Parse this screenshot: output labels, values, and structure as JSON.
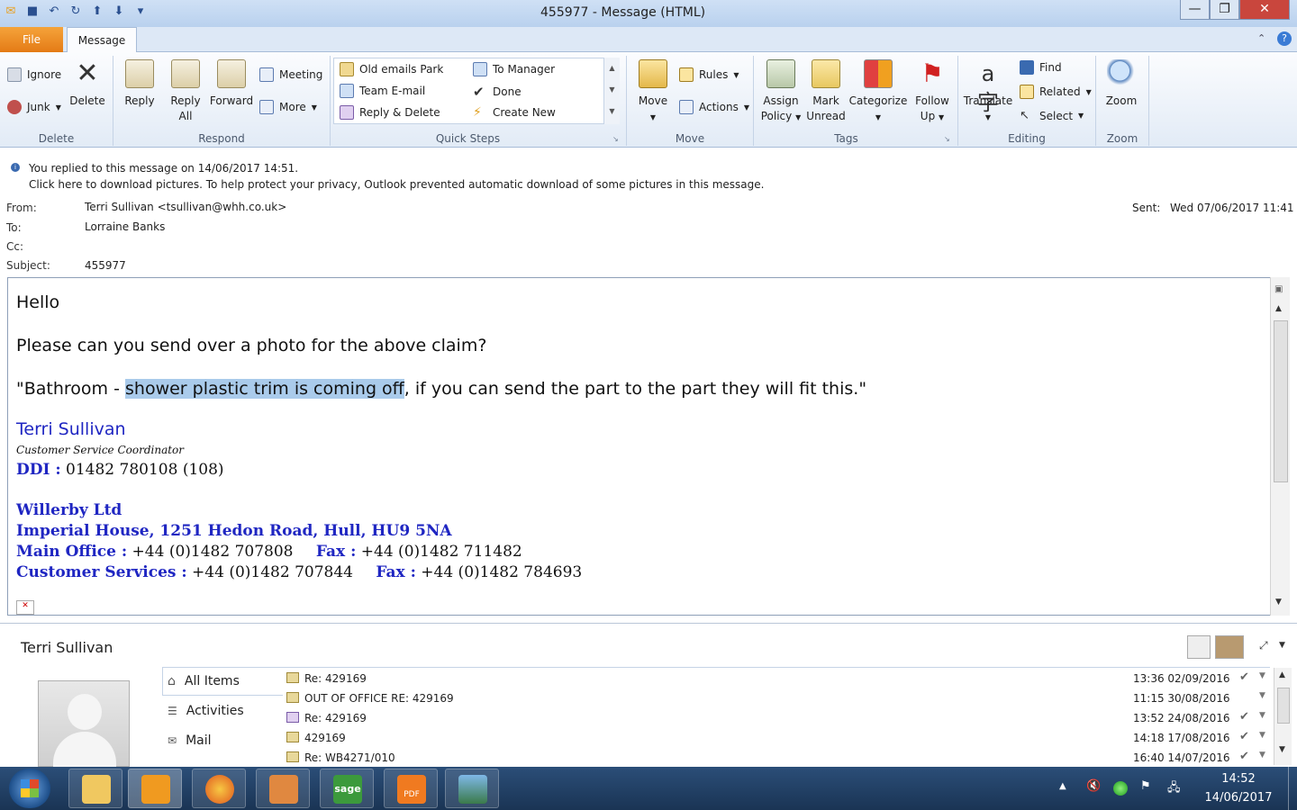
{
  "window": {
    "title": "455977 - Message (HTML)",
    "minimize": "—",
    "restore": "❐",
    "close": "✕"
  },
  "ribbon_tabs": {
    "file": "File",
    "message": "Message"
  },
  "groups": {
    "delete": {
      "label": "Delete",
      "ignore": "Ignore",
      "junk": "Junk",
      "delete": "Delete"
    },
    "respond": {
      "label": "Respond",
      "reply": "Reply",
      "reply_all_line1": "Reply",
      "reply_all_line2": "All",
      "forward": "Forward",
      "meeting": "Meeting",
      "more": "More"
    },
    "quick_steps": {
      "label": "Quick Steps",
      "items": [
        "Old emails Park",
        "To Manager",
        "Team E-mail",
        "Done",
        "Reply & Delete",
        "Create New"
      ]
    },
    "move": {
      "label": "Move",
      "move": "Move",
      "rules": "Rules",
      "actions": "Actions"
    },
    "tags": {
      "label": "Tags",
      "assign_policy_1": "Assign",
      "assign_policy_2": "Policy",
      "mark_unread_1": "Mark",
      "mark_unread_2": "Unread",
      "categorize": "Categorize",
      "follow_up_1": "Follow",
      "follow_up_2": "Up"
    },
    "editing": {
      "label": "Editing",
      "translate": "Translate",
      "find": "Find",
      "related": "Related",
      "select": "Select"
    },
    "zoom": {
      "label": "Zoom",
      "zoom": "Zoom"
    }
  },
  "infobar": {
    "line1": "You replied to this message on 14/06/2017 14:51.",
    "line2": "Click here to download pictures. To help protect your privacy, Outlook prevented automatic download of some pictures in this message."
  },
  "header": {
    "from_label": "From:",
    "from_value": "Terri Sullivan <tsullivan@whh.co.uk>",
    "to_label": "To:",
    "to_value": "Lorraine Banks",
    "cc_label": "Cc:",
    "subject_label": "Subject:",
    "subject_value": "455977",
    "sent_label": "Sent:",
    "sent_value": "Wed 07/06/2017 11:41"
  },
  "body": {
    "greeting": "Hello",
    "line1": "Please can you send over a photo for the above claim?",
    "quote_pre": "\"Bathroom - ",
    "quote_highlight": "shower plastic trim is coming off",
    "quote_post": ", if you can send the part to the part they will fit this.\"",
    "sig_name": "Terri Sullivan",
    "sig_role": "Customer Service Coordinator",
    "ddi_label": "DDI :",
    "ddi_value": " 01482 780108 (108)",
    "company": "Willerby Ltd",
    "address": "Imperial House, 1251 Hedon Road, Hull, HU9 5NA",
    "main_office_label": "Main Office :",
    "main_office_value": " +44 (0)1482 707808",
    "fax1_label": "Fax :",
    "fax1_value": " +44 (0)1482 711482",
    "cs_label": "Customer Services :",
    "cs_value": " +44 (0)1482 707844",
    "fax2_label": "Fax :",
    "fax2_value": " +44 (0)1482 784693"
  },
  "people_pane": {
    "name": "Terri Sullivan",
    "nav": [
      "All Items",
      "Activities",
      "Mail"
    ],
    "mails": [
      {
        "subject": "Re: 429169",
        "date": "13:36 02/09/2016",
        "check": "✔"
      },
      {
        "subject": "OUT OF OFFICE RE: 429169",
        "date": "11:15 30/08/2016",
        "check": ""
      },
      {
        "subject": "Re: 429169",
        "date": "13:52 24/08/2016",
        "check": "✔"
      },
      {
        "subject": "429169",
        "date": "14:18 17/08/2016",
        "check": "✔"
      },
      {
        "subject": "Re: WB4271/010",
        "date": "16:40 14/07/2016",
        "check": "✔"
      }
    ]
  },
  "taskbar": {
    "time": "14:52",
    "date": "14/06/2017",
    "apps": [
      "windows-explorer",
      "outlook",
      "firefox",
      "user-app",
      "sage",
      "pdf",
      "photo-viewer"
    ],
    "sage_label": "sage",
    "pdf_label": "PDF"
  }
}
